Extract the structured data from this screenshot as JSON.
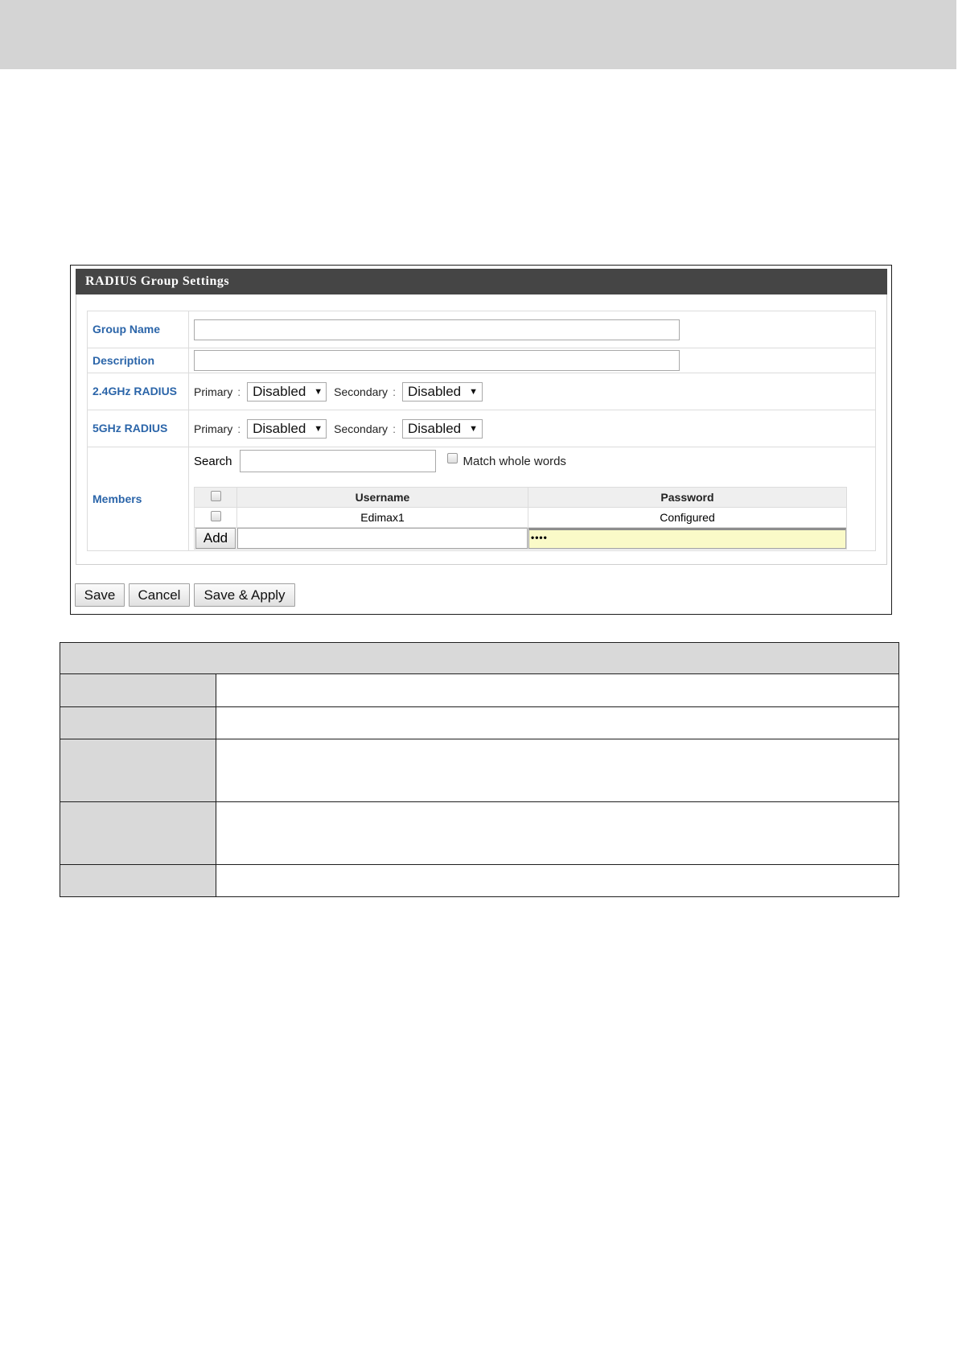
{
  "panel": {
    "title": "RADIUS Group Settings"
  },
  "form": {
    "group_name_label": "Group Name",
    "group_name_value": "",
    "description_label": "Description",
    "description_value": "",
    "radius_24_label": "2.4GHz RADIUS",
    "radius_5_label": "5GHz RADIUS",
    "primary_label": "Primary",
    "secondary_label": "Secondary",
    "colon": ":",
    "radius_24_primary": "Disabled",
    "radius_24_secondary": "Disabled",
    "radius_5_primary": "Disabled",
    "radius_5_secondary": "Disabled",
    "members_label": "Members",
    "search_label": "Search",
    "search_value": "",
    "match_whole_words_label": "Match whole words"
  },
  "members": {
    "columns": [
      "Username",
      "Password"
    ],
    "rows": [
      {
        "username": "Edimax1",
        "password": "Configured"
      }
    ],
    "add_label": "Add",
    "new_password_mask": "••••"
  },
  "buttons": {
    "save": "Save",
    "cancel": "Cancel",
    "save_apply": "Save & Apply"
  },
  "icons": {
    "dropdown": "triangle-down",
    "checkbox": "checkbox"
  }
}
